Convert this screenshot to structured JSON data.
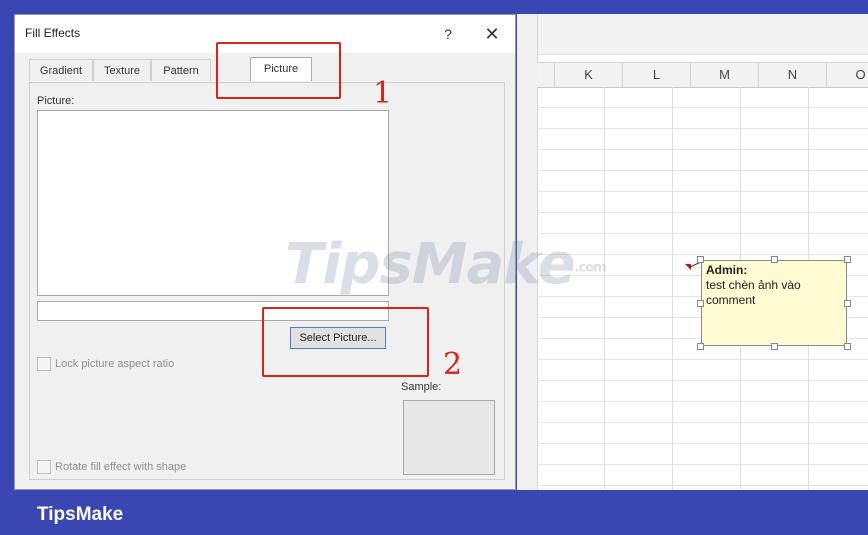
{
  "dialog": {
    "title": "Fill Effects",
    "help_label": "?",
    "close_label": "✕",
    "tabs": [
      "Gradient",
      "Texture",
      "Pattern",
      "Picture"
    ],
    "active_tab": "Picture",
    "picture_label": "Picture:",
    "select_picture_label": "Select Picture...",
    "lock_aspect_label": "Lock picture aspect ratio",
    "rotate_fill_label": "Rotate fill effect with shape",
    "sample_label": "Sample:"
  },
  "spreadsheet": {
    "columns": [
      "K",
      "L",
      "M",
      "N",
      "O"
    ],
    "comment": {
      "author": "Admin:",
      "text": "test chèn ảnh vào comment"
    }
  },
  "annotations": {
    "step1": "1",
    "step2": "2",
    "color": "#d4261c"
  },
  "watermark": {
    "text": "TipsMake",
    "suffix": ".com"
  },
  "brand": {
    "name": "TipsMake",
    "bar_color": "#3a47b2"
  }
}
